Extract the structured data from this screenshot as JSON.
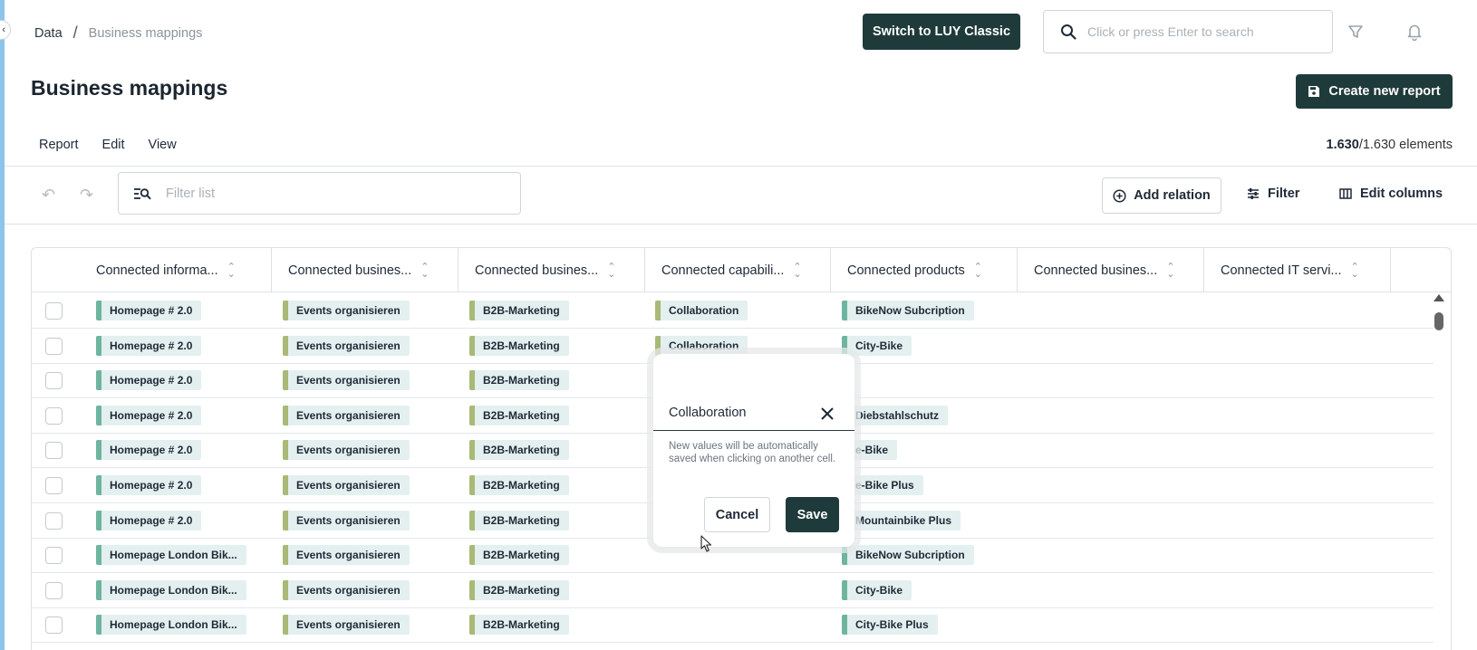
{
  "breadcrumb": {
    "root": "Data",
    "separator": "/",
    "current": "Business mappings"
  },
  "header": {
    "switch_label": "Switch to LUY Classic",
    "search_placeholder": "Click or press Enter to search",
    "icons": [
      "search-icon",
      "funnel-icon",
      "bell-icon"
    ]
  },
  "page": {
    "title": "Business mappings",
    "create_label": "Create new report"
  },
  "menu": {
    "report": "Report",
    "edit": "Edit",
    "view": "View"
  },
  "count": {
    "shown": "1.630",
    "total": "/1.630 elements"
  },
  "toolbar": {
    "filter_placeholder": "Filter list",
    "add_relation": "Add relation",
    "filter": "Filter",
    "edit_columns": "Edit columns"
  },
  "columns": [
    "Connected informa...",
    "Connected busines...",
    "Connected busines...",
    "Connected capabili...",
    "Connected products",
    "Connected busines...",
    "Connected IT servi..."
  ],
  "rows": [
    {
      "info": "Homepage # 2.0",
      "proc": "Events organisieren",
      "unit": "B2B-Marketing",
      "cap": "Collaboration",
      "prod": "BikeNow Subcription"
    },
    {
      "info": "Homepage # 2.0",
      "proc": "Events organisieren",
      "unit": "B2B-Marketing",
      "cap": "Collaboration",
      "prod": "City-Bike"
    },
    {
      "info": "Homepage # 2.0",
      "proc": "Events organisieren",
      "unit": "B2B-Marketing",
      "cap": "",
      "prod": ""
    },
    {
      "info": "Homepage # 2.0",
      "proc": "Events organisieren",
      "unit": "B2B-Marketing",
      "cap": "",
      "prod": "Diebstahlschutz"
    },
    {
      "info": "Homepage # 2.0",
      "proc": "Events organisieren",
      "unit": "B2B-Marketing",
      "cap": "",
      "prod": "e-Bike"
    },
    {
      "info": "Homepage # 2.0",
      "proc": "Events organisieren",
      "unit": "B2B-Marketing",
      "cap": "",
      "prod": "e-Bike Plus"
    },
    {
      "info": "Homepage # 2.0",
      "proc": "Events organisieren",
      "unit": "B2B-Marketing",
      "cap": "",
      "prod": "Mountainbike Plus"
    },
    {
      "info": "Homepage London Bik...",
      "proc": "Events organisieren",
      "unit": "B2B-Marketing",
      "cap": "",
      "prod": "BikeNow Subcription"
    },
    {
      "info": "Homepage London Bik...",
      "proc": "Events organisieren",
      "unit": "B2B-Marketing",
      "cap": "",
      "prod": "City-Bike"
    },
    {
      "info": "Homepage London Bik...",
      "proc": "Events organisieren",
      "unit": "B2B-Marketing",
      "cap": "",
      "prod": "City-Bike Plus"
    }
  ],
  "popover": {
    "value": "Collaboration",
    "hint": "New values will be automatically saved when clicking on another cell.",
    "cancel": "Cancel",
    "save": "Save"
  },
  "colors": {
    "primary": "#1f3a3a",
    "accent_bar": "#8cc4ea",
    "tag_bg": "#e4eff0",
    "tag_info": "#6eb5a0",
    "tag_business": "#a9b977"
  }
}
